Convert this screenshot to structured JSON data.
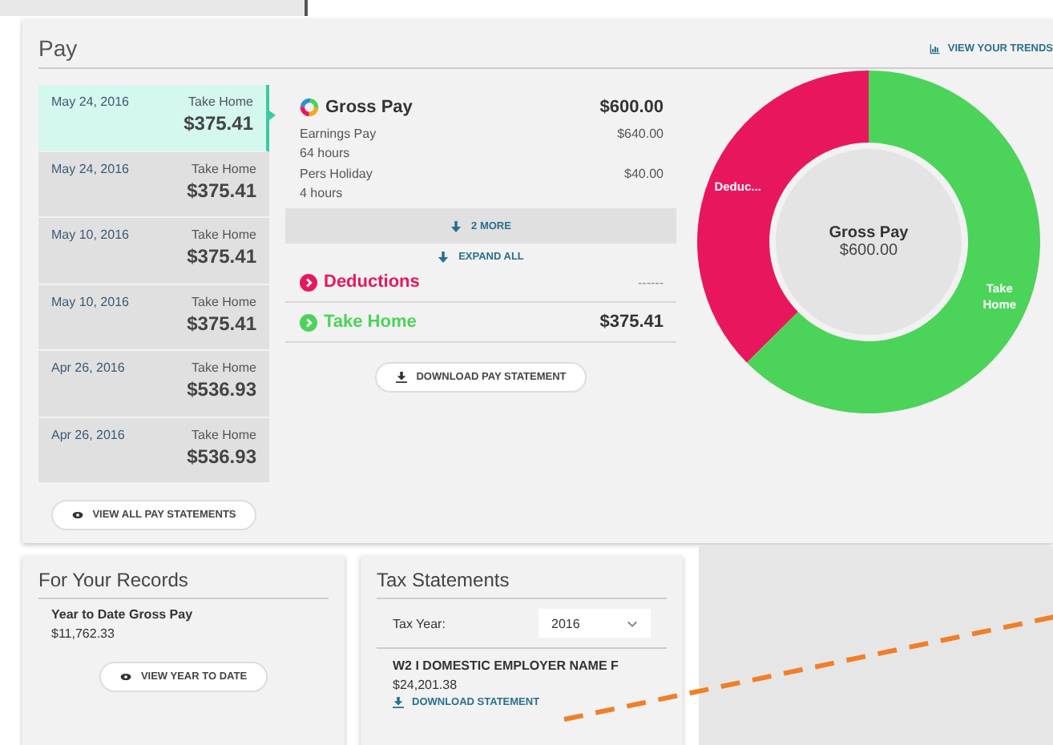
{
  "pay": {
    "title": "Pay",
    "trends_link": "VIEW YOUR TRENDS",
    "statements": [
      {
        "date": "May 24, 2016",
        "label": "Take Home",
        "amount": "$375.41",
        "selected": true
      },
      {
        "date": "May 24, 2016",
        "label": "Take Home",
        "amount": "$375.41",
        "selected": false
      },
      {
        "date": "May 10, 2016",
        "label": "Take Home",
        "amount": "$375.41",
        "selected": false
      },
      {
        "date": "May 10, 2016",
        "label": "Take Home",
        "amount": "$375.41",
        "selected": false
      },
      {
        "date": "Apr 26, 2016",
        "label": "Take Home",
        "amount": "$536.93",
        "selected": false
      },
      {
        "date": "Apr 26, 2016",
        "label": "Take Home",
        "amount": "$536.93",
        "selected": false
      }
    ],
    "view_all_button": "VIEW ALL PAY STATEMENTS",
    "gross_pay": {
      "title": "Gross Pay",
      "amount": "$600.00",
      "items": [
        {
          "name": "Earnings Pay",
          "hours": "64 hours",
          "amount": "$640.00"
        },
        {
          "name": "Pers Holiday",
          "hours": "4 hours",
          "amount": "$40.00"
        }
      ]
    },
    "more_button": "2 MORE",
    "expand_all": "EXPAND ALL",
    "deductions": {
      "title": "Deductions",
      "amount": "------",
      "color": "#e8175d"
    },
    "take_home": {
      "title": "Take Home",
      "amount": "$375.41",
      "color": "#4cd35a"
    },
    "download_button": "DOWNLOAD PAY STATEMENT",
    "chart": {
      "center_title": "Gross Pay",
      "center_amount": "$600.00",
      "chart_data": {
        "type": "donut",
        "categories": [
          "Deduc...",
          "Take Home"
        ],
        "values": [
          37.43,
          62.57
        ]
      }
    }
  },
  "records": {
    "title": "For Your Records",
    "ytd_label": "Year to Date Gross Pay",
    "ytd_amount": "$11,762.33",
    "button": "VIEW YEAR TO DATE"
  },
  "tax": {
    "title": "Tax Statements",
    "year_label": "Tax Year:",
    "year_value": "2016",
    "statement": {
      "name": "W2 I DOMESTIC EMPLOYER NAME F",
      "amount": "$24,201.38",
      "download": "DOWNLOAD STATEMENT"
    }
  }
}
